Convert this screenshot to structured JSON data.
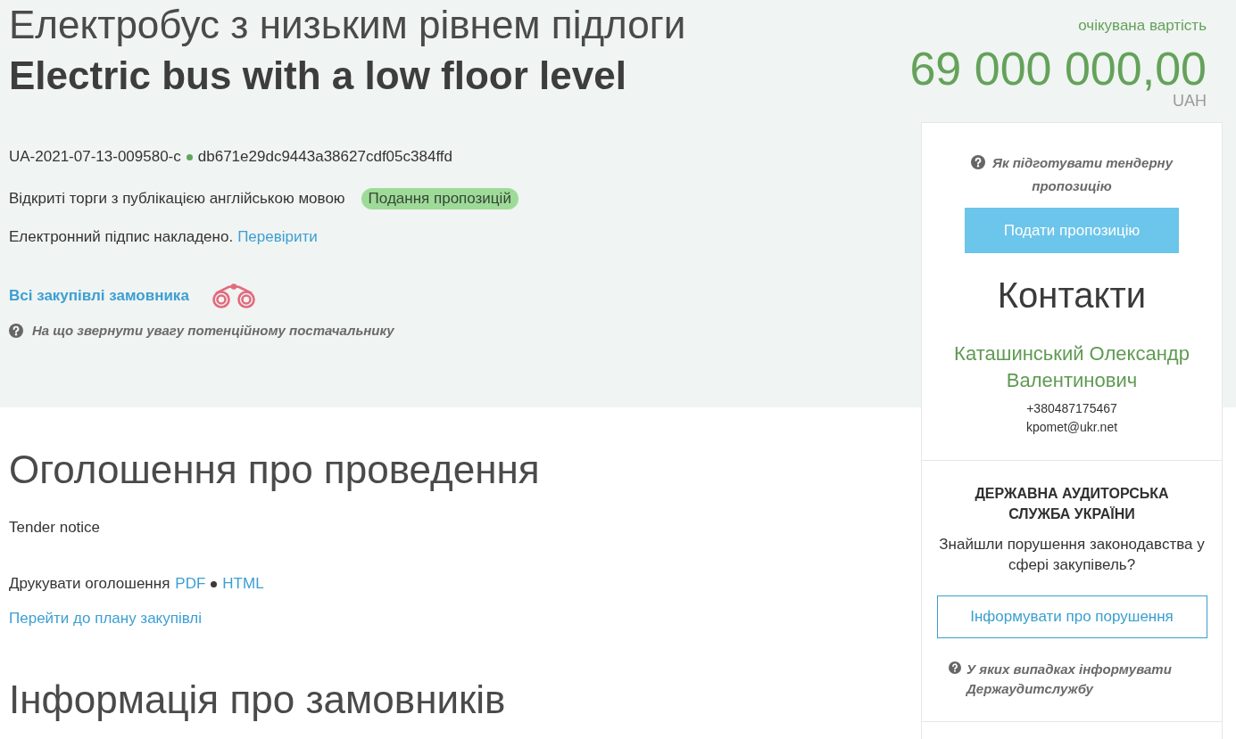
{
  "header": {
    "title_uk": "Електробус з низьким рівнем підлоги",
    "title_en": "Electric bus with a low floor level",
    "budget": {
      "label": "очікувана вартість",
      "amount": "69 000 000,00",
      "currency": "UAH"
    }
  },
  "tender": {
    "id": "UA-2021-07-13-009580-c",
    "hash": "db671e29dc9443a38627cdf05c384ffd",
    "procedure": "Відкриті торги з публікацією англійською мовою",
    "status_badge": "Подання пропозицій",
    "signature": {
      "text": "Електронний підпис накладено.",
      "link": "Перевірити"
    },
    "buyer_link": "Всі закупівлі замовника",
    "supplier_tip": "На що звернути увагу потенційному постачальнику"
  },
  "notice": {
    "heading": "Оголошення про проведення",
    "subtitle": "Tender notice",
    "print": {
      "label": "Друкувати оголошення",
      "links": [
        "PDF",
        "HTML"
      ]
    },
    "plan_link": "Перейти до плану закупівлі"
  },
  "buyers_heading": "Інформація про замовників",
  "sidebar": {
    "help_link": "Як підготувати тендерну пропозицію",
    "submit_button": "Подати пропозицію",
    "contacts": {
      "heading": "Контакти",
      "name": "Каташинський Олександр Валентинович",
      "phone": "+380487175467",
      "email": "kpomet@ukr.net"
    },
    "audit": {
      "title": "ДЕРЖАВНА АУДИТОРСЬКА СЛУЖБА УКРАЇНИ",
      "question": "Знайшли порушення законодавства у сфері закупівель?",
      "button": "Інформувати про порушення",
      "help_link": "У яких випадках інформувати Держаудитслужбу"
    }
  }
}
